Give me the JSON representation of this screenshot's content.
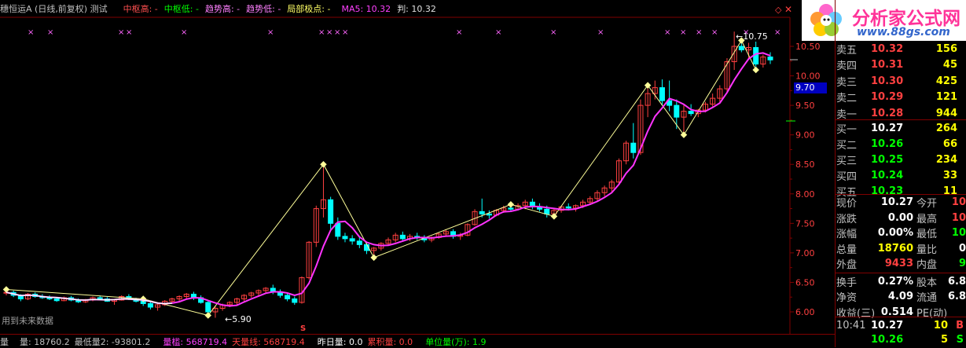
{
  "top_bar": {
    "title": "穗恒运A (日线,前复权) 测试",
    "items": [
      {
        "text": "中枢高: -",
        "color": "#ff5050"
      },
      {
        "text": "中枢低: -",
        "color": "#00ff00"
      },
      {
        "text": "趋势高: -",
        "color": "#ff80ff"
      },
      {
        "text": "趋势低: -",
        "color": "#ff80ff"
      },
      {
        "text": "局部极点: -",
        "color": "#ffff66"
      },
      {
        "text": "MA5: 10.32",
        "color": "#ff40ff"
      },
      {
        "text": "判: 10.32",
        "color": "#e0e0e0"
      }
    ]
  },
  "logo": {
    "name": "分析家公式网",
    "url": "www.88gs.com"
  },
  "chart": {
    "y_ticks": [
      "10.50",
      "10.00",
      "9.50",
      "9.00",
      "8.50",
      "8.00",
      "7.50",
      "7.00",
      "6.50",
      "6.00"
    ],
    "current_price_tag": "9.70",
    "high_label": "10.75",
    "low_label": "5.90",
    "watermark_text": "用到未来数据",
    "signal_marker": "S"
  },
  "quotes": {
    "sell": [
      {
        "label": "卖五",
        "price": "10.32",
        "vol": "156"
      },
      {
        "label": "卖四",
        "price": "10.31",
        "vol": "45"
      },
      {
        "label": "卖三",
        "price": "10.30",
        "vol": "425"
      },
      {
        "label": "卖二",
        "price": "10.29",
        "vol": "121"
      },
      {
        "label": "卖一",
        "price": "10.28",
        "vol": "944"
      }
    ],
    "buy": [
      {
        "label": "买一",
        "price": "10.27",
        "vol": "264"
      },
      {
        "label": "买二",
        "price": "10.26",
        "vol": "66"
      },
      {
        "label": "买三",
        "price": "10.25",
        "vol": "234"
      },
      {
        "label": "买四",
        "price": "10.24",
        "vol": "33"
      },
      {
        "label": "买五",
        "price": "10.23",
        "vol": "11"
      }
    ]
  },
  "info": [
    {
      "l1": "现价",
      "v1": "10.27",
      "c1": "#ffffff",
      "l2": "今开",
      "v2": "10",
      "c2": "#ff4040"
    },
    {
      "l1": "涨跌",
      "v1": "0.00",
      "c1": "#ffffff",
      "l2": "最高",
      "v2": "10",
      "c2": "#ff4040"
    },
    {
      "l1": "涨幅",
      "v1": "0.00%",
      "c1": "#ffffff",
      "l2": "最低",
      "v2": "10",
      "c2": "#00ff00"
    },
    {
      "l1": "总量",
      "v1": "18760",
      "c1": "#ffff00",
      "l2": "量比",
      "v2": "0",
      "c2": "#ffffff"
    },
    {
      "l1": "外盘",
      "v1": "9433",
      "c1": "#ff4040",
      "l2": "内盘",
      "v2": "9",
      "c2": "#00ff00"
    },
    {
      "l1": "换手",
      "v1": "0.27%",
      "c1": "#ffffff",
      "l2": "股本",
      "v2": "6.8",
      "c2": "#ffffff"
    },
    {
      "l1": "净资",
      "v1": "4.09",
      "c1": "#ffffff",
      "l2": "流通",
      "v2": "6.8",
      "c2": "#ffffff"
    },
    {
      "l1": "收益(三)",
      "v1": "0.514",
      "c1": "#ffffff",
      "l2": "PE(动)",
      "v2": "",
      "c2": "#ffffff"
    }
  ],
  "ticks": [
    {
      "time": "10:41",
      "price": "10.27",
      "vol": "10",
      "side": "B"
    },
    {
      "time": "",
      "price": "10.26",
      "vol": "5",
      "side": "S"
    }
  ],
  "bottom_bar": {
    "items": [
      {
        "text": "量",
        "color": "#c0c0c0"
      },
      {
        "text": "量: 18760.2",
        "color": "#c0c0c0"
      },
      {
        "text": "最低量2: -93801.2",
        "color": "#c0c0c0"
      },
      {
        "text": "量槛: 568719.4",
        "color": "#ff40ff"
      },
      {
        "text": "天量线: 568719.4",
        "color": "#ff4040"
      },
      {
        "text": "昨日量: 0.0",
        "color": "#ffffff"
      },
      {
        "text": "累积量: 0.0",
        "color": "#ff4040"
      },
      {
        "text": "单位量(万): 1.9",
        "color": "#00ff00"
      }
    ]
  },
  "colors": {
    "up": "#ff4040",
    "down": "#00ffff",
    "ma": "#ff33ff",
    "zigzag": "#ffff99",
    "axis": "#800000",
    "tick": "#ff4040"
  }
}
